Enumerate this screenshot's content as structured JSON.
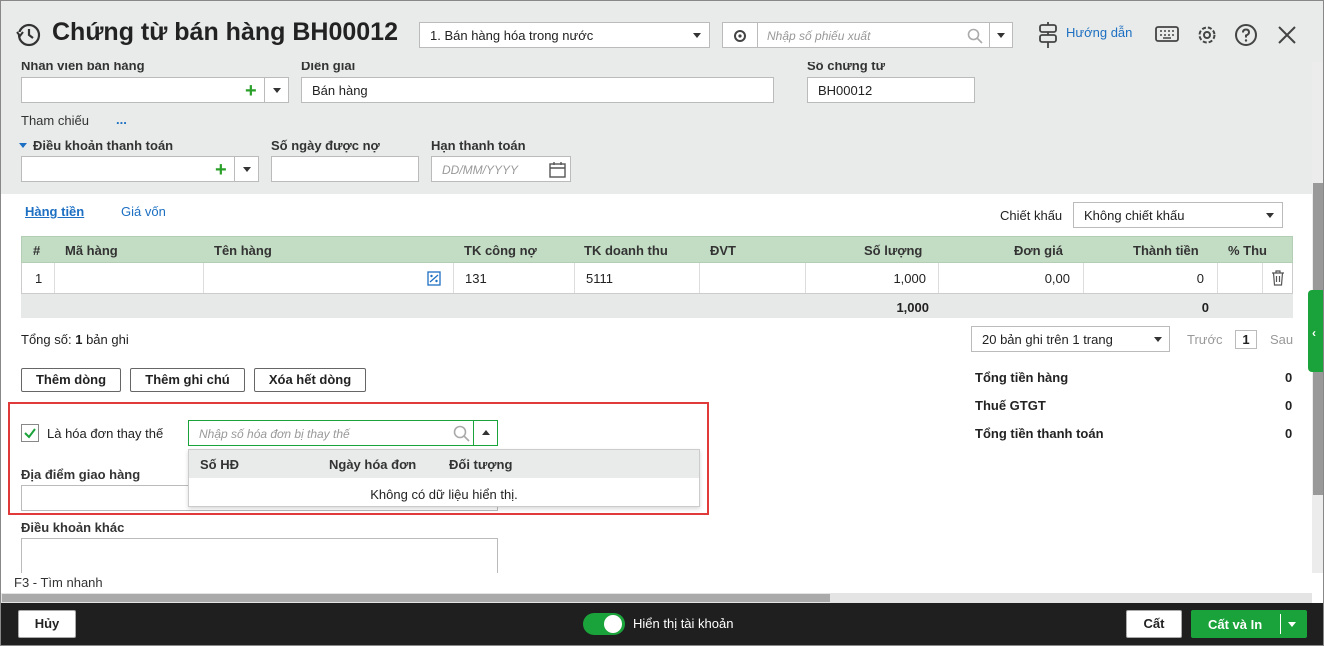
{
  "header": {
    "title": "Chứng từ bán hàng BH00012",
    "sale_type": "1. Bán hàng hóa trong nước",
    "export_placeholder": "Nhập số phiếu xuất",
    "guide_label": "Hướng dẫn"
  },
  "form": {
    "salesperson_label": "Nhân viên bán hàng",
    "description_label": "Diễn giải",
    "description_value": "Bán hàng",
    "voucher_no_label": "Số chứng từ",
    "voucher_no_value": "BH00012",
    "reference_label": "Tham chiếu",
    "reference_more": "...",
    "payment_terms_label": "Điều khoản thanh toán",
    "credit_days_label": "Số ngày được nợ",
    "due_date_label": "Hạn thanh toán",
    "due_date_placeholder": "DD/MM/YYYY"
  },
  "tabs": [
    {
      "label": "Hàng tiền",
      "active": true
    },
    {
      "label": "Giá vốn",
      "active": false
    }
  ],
  "discount": {
    "label": "Chiết khấu",
    "value": "Không chiết khấu"
  },
  "grid": {
    "columns": [
      "#",
      "Mã hàng",
      "Tên hàng",
      "TK công nợ",
      "TK doanh thu",
      "ĐVT",
      "Số lượng",
      "Đơn giá",
      "Thành tiền",
      "% Thu"
    ],
    "rows": [
      {
        "no": "1",
        "code": "",
        "name": "",
        "debt_account": "131",
        "revenue_account": "5111",
        "unit": "",
        "quantity": "1,000",
        "unit_price": "0,00",
        "amount": "0"
      }
    ],
    "footer": {
      "quantity": "1,000",
      "amount": "0"
    }
  },
  "pagination": {
    "total_prefix": "Tổng số:",
    "total_count": "1",
    "total_suffix": "bản ghi",
    "page_size": "20 bản ghi trên 1 trang",
    "prev": "Trước",
    "page": "1",
    "next": "Sau"
  },
  "buttons": {
    "add_row": "Thêm dòng",
    "add_note": "Thêm ghi chú",
    "delete_all": "Xóa hết dòng"
  },
  "summary": [
    {
      "label": "Tổng tiền hàng",
      "value": "0"
    },
    {
      "label": "Thuế GTGT",
      "value": "0"
    },
    {
      "label": "Tổng tiền thanh toán",
      "value": "0"
    }
  ],
  "replacement": {
    "checkbox_label": "Là hóa đơn thay thế",
    "checked": true,
    "search_placeholder": "Nhập số hóa đơn bị thay thế",
    "dropdown_columns": [
      "Số HĐ",
      "Ngày hóa đơn",
      "Đối tượng"
    ],
    "empty_text": "Không có dữ liệu hiển thị."
  },
  "delivery_label": "Địa điểm giao hàng",
  "other_terms_label": "Điều khoản khác",
  "status_hint": "F3 - Tìm nhanh",
  "footer": {
    "cancel": "Hủy",
    "show_account": "Hiển thị tài khoản",
    "save": "Cất",
    "save_print": "Cất và In"
  },
  "colors": {
    "brand_green": "#1aa33a",
    "link_blue": "#1c6fc2",
    "highlight_red": "#e03a3a",
    "grid_header": "#c3dcc4"
  }
}
